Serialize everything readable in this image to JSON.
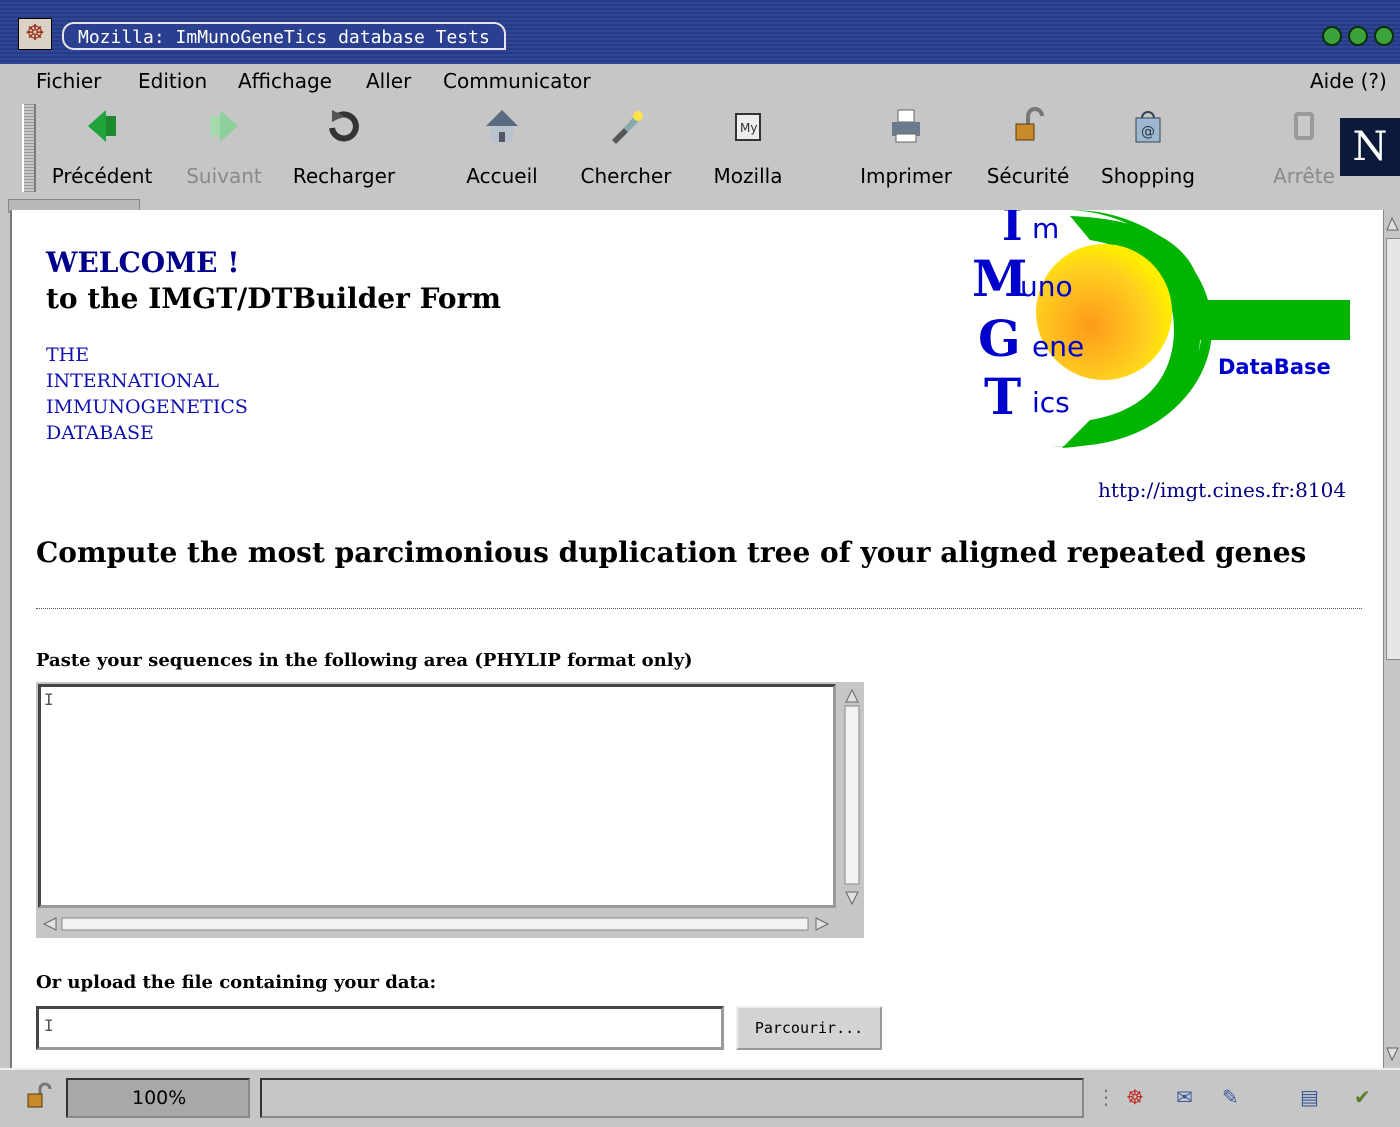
{
  "window": {
    "title": "Mozilla: ImMunoGeneTics database Tests"
  },
  "menu": [
    "Fichier",
    "Edition",
    "Affichage",
    "Aller",
    "Communicator"
  ],
  "menu_help": "Aide (?)",
  "toolbar": [
    {
      "label": "Précédent",
      "icon": "back-arrow-icon",
      "enabled": true
    },
    {
      "label": "Suivant",
      "icon": "forward-arrow-icon",
      "enabled": false
    },
    {
      "label": "Recharger",
      "icon": "reload-icon",
      "enabled": true
    },
    {
      "label": "Accueil",
      "icon": "home-icon",
      "enabled": true
    },
    {
      "label": "Chercher",
      "icon": "search-flashlight-icon",
      "enabled": true
    },
    {
      "label": "Mozilla",
      "icon": "my-mozilla-icon",
      "enabled": true
    },
    {
      "label": "Imprimer",
      "icon": "printer-icon",
      "enabled": true
    },
    {
      "label": "Sécurité",
      "icon": "padlock-icon",
      "enabled": true
    },
    {
      "label": "Shopping",
      "icon": "shopping-bag-icon",
      "enabled": true
    },
    {
      "label": "Arrête",
      "icon": "stop-icon",
      "enabled": false
    }
  ],
  "page": {
    "welcome": "WELCOME !",
    "form_title": "to the IMGT/DTBuilder Form",
    "org_lines": [
      "THE",
      "INTERNATIONAL",
      "IMMUNOGENETICS",
      "DATABASE"
    ],
    "logo": {
      "letters": [
        "I",
        "M",
        "G",
        "T"
      ],
      "suffixes": [
        "m",
        "uno",
        "ene",
        "ics"
      ],
      "tag": "DataBase",
      "colors": {
        "green": "#00b400",
        "orange": "#ff9a1a",
        "yellow": "#ffee00",
        "blue": "#0000cc"
      }
    },
    "url": "http://imgt.cines.fr:8104",
    "heading": "Compute the most parcimonious duplication tree of your aligned repeated genes",
    "paste_label": "Paste your sequences in the following area (PHYLIP format only)",
    "textarea_value": "",
    "upload_label": "Or upload the file containing your data:",
    "file_value": "",
    "browse_label": "Parcourir..."
  },
  "status": {
    "progress": "100%"
  }
}
